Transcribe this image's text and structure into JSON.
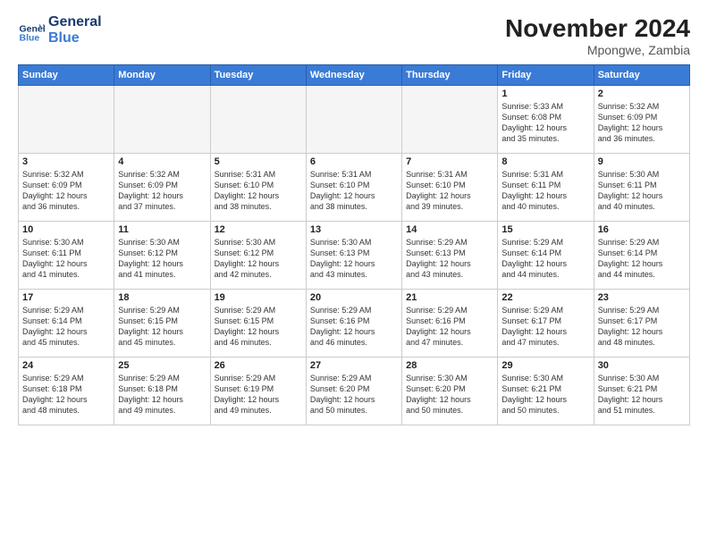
{
  "header": {
    "logo_line1": "General",
    "logo_line2": "Blue",
    "month": "November 2024",
    "location": "Mpongwe, Zambia"
  },
  "days_of_week": [
    "Sunday",
    "Monday",
    "Tuesday",
    "Wednesday",
    "Thursday",
    "Friday",
    "Saturday"
  ],
  "weeks": [
    [
      {
        "day": "",
        "info": ""
      },
      {
        "day": "",
        "info": ""
      },
      {
        "day": "",
        "info": ""
      },
      {
        "day": "",
        "info": ""
      },
      {
        "day": "",
        "info": ""
      },
      {
        "day": "1",
        "info": "Sunrise: 5:33 AM\nSunset: 6:08 PM\nDaylight: 12 hours\nand 35 minutes."
      },
      {
        "day": "2",
        "info": "Sunrise: 5:32 AM\nSunset: 6:09 PM\nDaylight: 12 hours\nand 36 minutes."
      }
    ],
    [
      {
        "day": "3",
        "info": "Sunrise: 5:32 AM\nSunset: 6:09 PM\nDaylight: 12 hours\nand 36 minutes."
      },
      {
        "day": "4",
        "info": "Sunrise: 5:32 AM\nSunset: 6:09 PM\nDaylight: 12 hours\nand 37 minutes."
      },
      {
        "day": "5",
        "info": "Sunrise: 5:31 AM\nSunset: 6:10 PM\nDaylight: 12 hours\nand 38 minutes."
      },
      {
        "day": "6",
        "info": "Sunrise: 5:31 AM\nSunset: 6:10 PM\nDaylight: 12 hours\nand 38 minutes."
      },
      {
        "day": "7",
        "info": "Sunrise: 5:31 AM\nSunset: 6:10 PM\nDaylight: 12 hours\nand 39 minutes."
      },
      {
        "day": "8",
        "info": "Sunrise: 5:31 AM\nSunset: 6:11 PM\nDaylight: 12 hours\nand 40 minutes."
      },
      {
        "day": "9",
        "info": "Sunrise: 5:30 AM\nSunset: 6:11 PM\nDaylight: 12 hours\nand 40 minutes."
      }
    ],
    [
      {
        "day": "10",
        "info": "Sunrise: 5:30 AM\nSunset: 6:11 PM\nDaylight: 12 hours\nand 41 minutes."
      },
      {
        "day": "11",
        "info": "Sunrise: 5:30 AM\nSunset: 6:12 PM\nDaylight: 12 hours\nand 41 minutes."
      },
      {
        "day": "12",
        "info": "Sunrise: 5:30 AM\nSunset: 6:12 PM\nDaylight: 12 hours\nand 42 minutes."
      },
      {
        "day": "13",
        "info": "Sunrise: 5:30 AM\nSunset: 6:13 PM\nDaylight: 12 hours\nand 43 minutes."
      },
      {
        "day": "14",
        "info": "Sunrise: 5:29 AM\nSunset: 6:13 PM\nDaylight: 12 hours\nand 43 minutes."
      },
      {
        "day": "15",
        "info": "Sunrise: 5:29 AM\nSunset: 6:14 PM\nDaylight: 12 hours\nand 44 minutes."
      },
      {
        "day": "16",
        "info": "Sunrise: 5:29 AM\nSunset: 6:14 PM\nDaylight: 12 hours\nand 44 minutes."
      }
    ],
    [
      {
        "day": "17",
        "info": "Sunrise: 5:29 AM\nSunset: 6:14 PM\nDaylight: 12 hours\nand 45 minutes."
      },
      {
        "day": "18",
        "info": "Sunrise: 5:29 AM\nSunset: 6:15 PM\nDaylight: 12 hours\nand 45 minutes."
      },
      {
        "day": "19",
        "info": "Sunrise: 5:29 AM\nSunset: 6:15 PM\nDaylight: 12 hours\nand 46 minutes."
      },
      {
        "day": "20",
        "info": "Sunrise: 5:29 AM\nSunset: 6:16 PM\nDaylight: 12 hours\nand 46 minutes."
      },
      {
        "day": "21",
        "info": "Sunrise: 5:29 AM\nSunset: 6:16 PM\nDaylight: 12 hours\nand 47 minutes."
      },
      {
        "day": "22",
        "info": "Sunrise: 5:29 AM\nSunset: 6:17 PM\nDaylight: 12 hours\nand 47 minutes."
      },
      {
        "day": "23",
        "info": "Sunrise: 5:29 AM\nSunset: 6:17 PM\nDaylight: 12 hours\nand 48 minutes."
      }
    ],
    [
      {
        "day": "24",
        "info": "Sunrise: 5:29 AM\nSunset: 6:18 PM\nDaylight: 12 hours\nand 48 minutes."
      },
      {
        "day": "25",
        "info": "Sunrise: 5:29 AM\nSunset: 6:18 PM\nDaylight: 12 hours\nand 49 minutes."
      },
      {
        "day": "26",
        "info": "Sunrise: 5:29 AM\nSunset: 6:19 PM\nDaylight: 12 hours\nand 49 minutes."
      },
      {
        "day": "27",
        "info": "Sunrise: 5:29 AM\nSunset: 6:20 PM\nDaylight: 12 hours\nand 50 minutes."
      },
      {
        "day": "28",
        "info": "Sunrise: 5:30 AM\nSunset: 6:20 PM\nDaylight: 12 hours\nand 50 minutes."
      },
      {
        "day": "29",
        "info": "Sunrise: 5:30 AM\nSunset: 6:21 PM\nDaylight: 12 hours\nand 50 minutes."
      },
      {
        "day": "30",
        "info": "Sunrise: 5:30 AM\nSunset: 6:21 PM\nDaylight: 12 hours\nand 51 minutes."
      }
    ]
  ]
}
